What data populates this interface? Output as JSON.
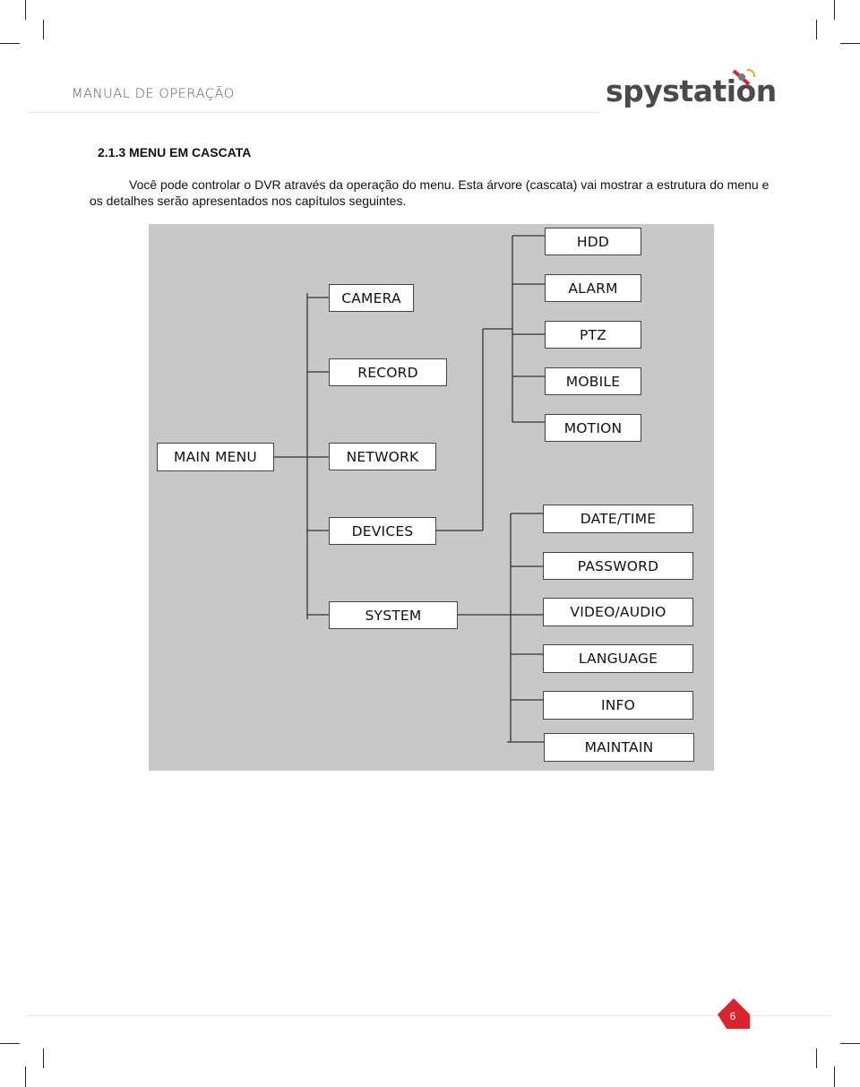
{
  "header": {
    "title": "MANUAL DE OPERAÇÃO",
    "logo": "spystation"
  },
  "section": {
    "title": "2.1.3 MENU EM CASCATA",
    "intro": "Você pode controlar o DVR através da operação do menu. Esta árvore (cascata) vai mostrar a estrutura do menu e os detalhes serão apresentados nos capítulos seguintes."
  },
  "diagram": {
    "root": "MAIN MENU",
    "main_items": [
      "CAMERA",
      "RECORD",
      "NETWORK",
      "DEVICES",
      "SYSTEM"
    ],
    "devices_items": [
      "HDD",
      "ALARM",
      "PTZ",
      "MOBILE",
      "MOTION"
    ],
    "system_items": [
      "DATE/TIME",
      "PASSWORD",
      "VIDEO/AUDIO",
      "LANGUAGE",
      "INFO",
      "MAINTAIN"
    ]
  },
  "footer": {
    "page_number": "6",
    "badge_color": "#d9232d"
  },
  "colors": {
    "diagram_bg": "#c8c8c8",
    "accent": "#d9232d"
  }
}
